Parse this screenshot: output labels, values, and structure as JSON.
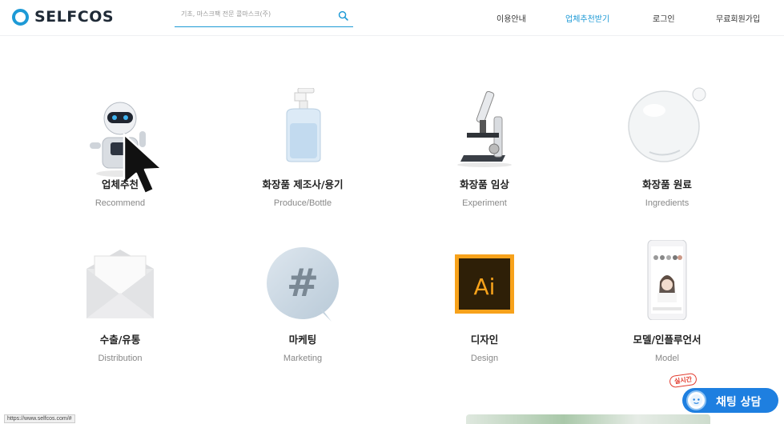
{
  "header": {
    "logo_text": "SELFCOS",
    "search_placeholder": "기초, 마스크팩 전문 콜마스크(주)",
    "nav": [
      "이용안내",
      "업체추천받기",
      "로그인",
      "무료회원가입"
    ]
  },
  "cards": [
    {
      "title": "업체추천",
      "subtitle": "Recommend",
      "icon": "robot-icon"
    },
    {
      "title": "화장품 제조사/용기",
      "subtitle": "Produce/Bottle",
      "icon": "pump-bottle-icon"
    },
    {
      "title": "화장품 임상",
      "subtitle": "Experiment",
      "icon": "microscope-icon"
    },
    {
      "title": "화장품 원료",
      "subtitle": "Ingredients",
      "icon": "bubble-icon"
    },
    {
      "title": "수출/유통",
      "subtitle": "Distribution",
      "icon": "envelope-icon"
    },
    {
      "title": "마케팅",
      "subtitle": "Marketing",
      "icon": "hashtag-icon"
    },
    {
      "title": "디자인",
      "subtitle": "Design",
      "icon": "illustrator-icon"
    },
    {
      "title": "모델/인플루언서",
      "subtitle": "Model",
      "icon": "phone-model-icon"
    }
  ],
  "illustrator_text": "Ai",
  "hashtag_text": "#",
  "status_url": "https://www.selfcos.com/#",
  "chat": {
    "label": "채팅 상담",
    "badge": "실시간"
  },
  "colors": {
    "accent": "#1e9ad6",
    "chat": "#1e7fe0",
    "badge": "#e23b2e"
  }
}
